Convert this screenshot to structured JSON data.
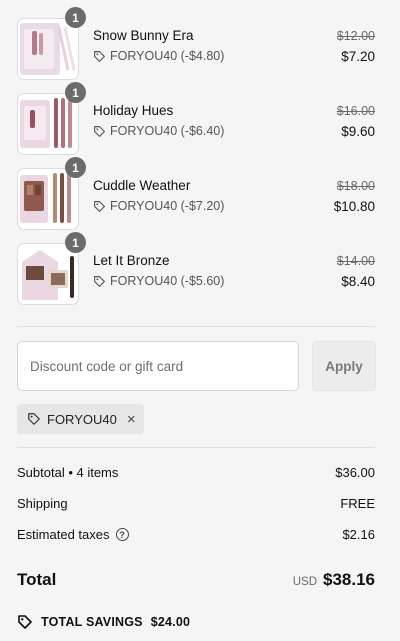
{
  "items": [
    {
      "name": "Snow Bunny Era",
      "quantity": "1",
      "discount": "FORYOU40 (-$4.80)",
      "compare_price": "$12.00",
      "price": "$7.20"
    },
    {
      "name": "Holiday Hues",
      "quantity": "1",
      "discount": "FORYOU40 (-$6.40)",
      "compare_price": "$16.00",
      "price": "$9.60"
    },
    {
      "name": "Cuddle Weather",
      "quantity": "1",
      "discount": "FORYOU40 (-$7.20)",
      "compare_price": "$18.00",
      "price": "$10.80"
    },
    {
      "name": "Let It Bronze",
      "quantity": "1",
      "discount": "FORYOU40 (-$5.60)",
      "compare_price": "$14.00",
      "price": "$8.40"
    }
  ],
  "discount": {
    "placeholder": "Discount code or gift card",
    "value": "",
    "apply_label": "Apply",
    "applied_code": "FORYOU40",
    "remove_icon": "×"
  },
  "summary": {
    "subtotal_label": "Subtotal • 4 items",
    "subtotal_value": "$36.00",
    "shipping_label": "Shipping",
    "shipping_value": "FREE",
    "taxes_label": "Estimated taxes",
    "taxes_value": "$2.16",
    "total_label": "Total",
    "currency": "USD",
    "total_value": "$38.16",
    "savings_label": "TOTAL SAVINGS",
    "savings_value": "$24.00"
  },
  "icons": {
    "tag": "tag-icon",
    "info": "info-icon",
    "close": "close-icon",
    "savings": "savings-tag-icon"
  },
  "colors": {
    "background": "#f5f5f5",
    "badge": "#6b6b6b",
    "thumb_pink": "#e8d3de",
    "divider": "#dedede"
  }
}
